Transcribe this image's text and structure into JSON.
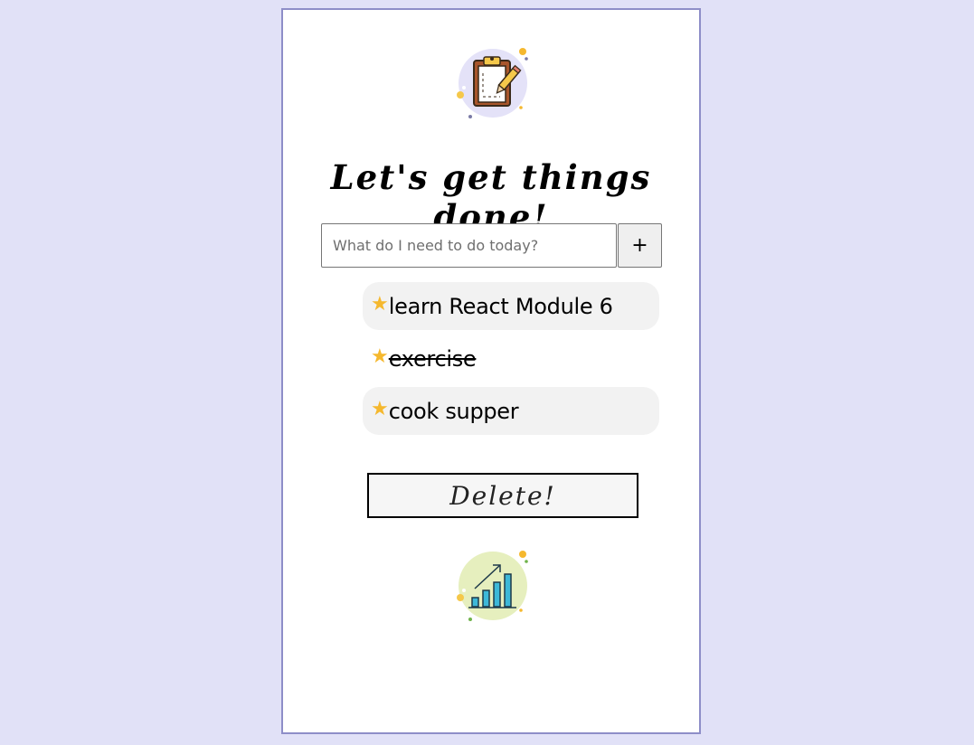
{
  "header": {
    "title": "Let's get things done!",
    "illustration_icon": "clipboard-pencil-icon"
  },
  "add_task": {
    "placeholder": "What do I need to do today?",
    "value": "",
    "add_button_label": "+"
  },
  "tasks": [
    {
      "label": "learn React Module 6",
      "done": false,
      "highlighted": true,
      "icon": "star-icon"
    },
    {
      "label": "exercise",
      "done": true,
      "highlighted": false,
      "icon": "star-icon"
    },
    {
      "label": "cook supper",
      "done": false,
      "highlighted": true,
      "icon": "star-icon"
    }
  ],
  "star_glyph": "★",
  "delete_button_label": "Delete!",
  "footer": {
    "illustration_icon": "growth-chart-icon"
  },
  "colors": {
    "page_background": "#e1e1f7",
    "card_border": "#8e8ec8",
    "star": "#f5b82e",
    "task_highlight": "#f2f2f2"
  }
}
